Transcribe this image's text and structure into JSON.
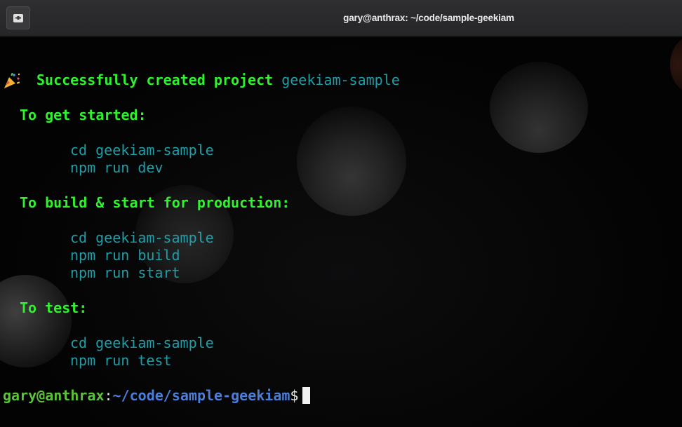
{
  "window": {
    "title": "gary@anthrax: ~/code/sample-geekiam"
  },
  "terminal": {
    "success_prefix": "Successfully created project",
    "project_name": "geekiam-sample",
    "sections": [
      {
        "heading": "To get started:",
        "commands": [
          "cd geekiam-sample",
          "npm run dev"
        ]
      },
      {
        "heading": "To build & start for production:",
        "commands": [
          "cd geekiam-sample",
          "npm run build",
          "npm run start"
        ]
      },
      {
        "heading": "To test:",
        "commands": [
          "cd geekiam-sample",
          "npm run test"
        ]
      }
    ],
    "prompt": {
      "user_host": "gary@anthrax",
      "colon": ":",
      "path": "~/code/sample-geekiam",
      "symbol": "$"
    },
    "icons": {
      "new_tab": "new-tab-icon",
      "party": "party-popper-icon"
    },
    "colors": {
      "heading": "#2ff22f",
      "command": "#1f9ea8",
      "prompt_user": "#5bc23a",
      "prompt_path": "#4c7dd8"
    }
  }
}
